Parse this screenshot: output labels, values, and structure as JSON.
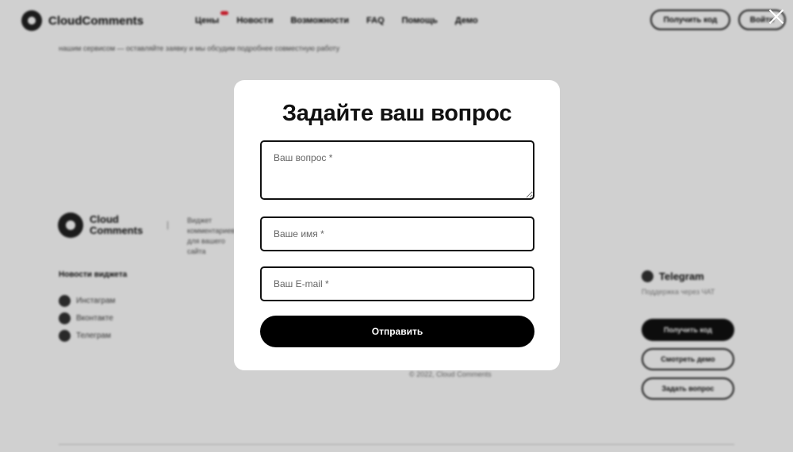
{
  "header": {
    "logo_text": "CloudComments",
    "nav": [
      "Цены",
      "Новости",
      "Возможности",
      "FAQ",
      "Помощь",
      "Демо"
    ],
    "get_code_button": "Получить код",
    "login_button": "Войти"
  },
  "background": {
    "subline": "нашим сервисом — оставляйте заявку и мы обсудим подробнее совместную работу",
    "footer_logo_text": [
      "Cloud",
      "Comments"
    ],
    "footer_description": "Виджет комментариев для вашего сайта",
    "col1_heading": "Новости виджета",
    "social": [
      "Инстаграм",
      "Вконтакте",
      "Телеграм"
    ],
    "telegram_title": "Telegram",
    "telegram_sub": "Поддержка через ЧАТ",
    "footer_buttons": [
      "Получить код",
      "Смотреть демо",
      "Задать вопрос"
    ],
    "copyright": "© 2022, Cloud Comments"
  },
  "modal": {
    "title": "Задайте ваш вопрос",
    "question_placeholder": "Ваш вопрос *",
    "name_placeholder": "Ваше имя *",
    "email_placeholder": "Ваш E-mail *",
    "submit_label": "Отправить"
  }
}
